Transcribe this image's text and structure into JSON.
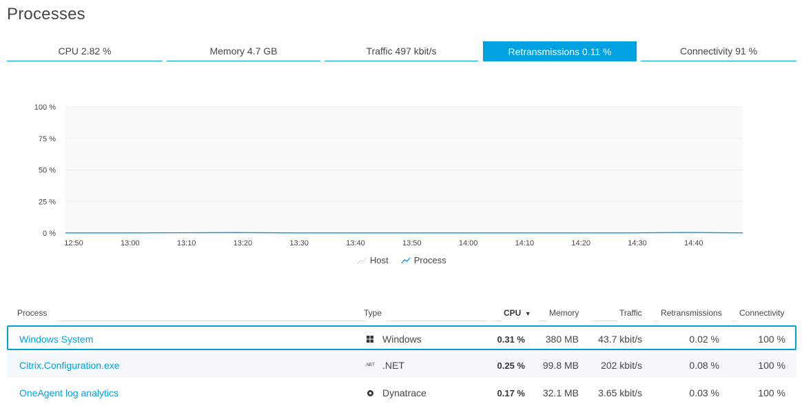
{
  "page": {
    "title": "Processes"
  },
  "tabs": [
    {
      "label": "CPU 2.82 %",
      "active": false
    },
    {
      "label": "Memory 4.7 GB",
      "active": false
    },
    {
      "label": "Traffic 497 kbit/s",
      "active": false
    },
    {
      "label": "Retransmissions 0.11 %",
      "active": true
    },
    {
      "label": "Connectivity 91 %",
      "active": false
    }
  ],
  "colors": {
    "accent": "#00a1e0",
    "text": "#454646",
    "grid": "#eeeeee"
  },
  "chart_data": {
    "type": "line",
    "title": "",
    "ylabel": "",
    "xlabel": "",
    "y_ticks": [
      "100 %",
      "75 %",
      "50 %",
      "25 %",
      "0 %"
    ],
    "ylim": [
      0,
      100
    ],
    "x_ticks": [
      "12:50",
      "13:00",
      "13:10",
      "13:20",
      "13:30",
      "13:40",
      "13:50",
      "14:00",
      "14:10",
      "14:20",
      "14:30",
      "14:40"
    ],
    "grid": true,
    "legend_position": "bottom-center",
    "series": [
      {
        "name": "Host",
        "style": "dotted",
        "color": "#bbbbbb",
        "values": [
          0,
          0,
          0,
          0,
          0,
          0,
          0,
          0,
          0,
          0,
          0,
          0,
          0
        ]
      },
      {
        "name": "Process",
        "style": "line",
        "color": "#00a1e0",
        "values": [
          0.1,
          0.1,
          0.2,
          0.4,
          0.1,
          0.1,
          0.1,
          0.1,
          0.1,
          0.1,
          0.1,
          0.5,
          0.1
        ]
      }
    ]
  },
  "legend": {
    "host_label": "Host",
    "process_label": "Process"
  },
  "table": {
    "columns": {
      "process": "Process",
      "type": "Type",
      "cpu": "CPU",
      "cpu_sort": "▼",
      "memory": "Memory",
      "traffic": "Traffic",
      "retransmissions": "Retransmissions",
      "connectivity": "Connectivity"
    },
    "rows": [
      {
        "process": "Windows System",
        "type_icon": "windows-icon",
        "type": "Windows",
        "cpu": "0.31 %",
        "memory": "380 MB",
        "traffic": "43.7 kbit/s",
        "retransmissions": "0.02 %",
        "connectivity": "100 %",
        "selected": true
      },
      {
        "process": "Citrix.Configuration.exe",
        "type_icon": "dotnet-icon",
        "type_icon_text": ".NET",
        "type": ".NET",
        "cpu": "0.25 %",
        "memory": "99.8 MB",
        "traffic": "202 kbit/s",
        "retransmissions": "0.08 %",
        "connectivity": "100 %",
        "selected": false
      },
      {
        "process": "OneAgent log analytics",
        "type_icon": "dynatrace-icon",
        "type": "Dynatrace",
        "cpu": "0.17 %",
        "memory": "32.1 MB",
        "traffic": "3.65 kbit/s",
        "retransmissions": "0.03 %",
        "connectivity": "100 %",
        "selected": false
      }
    ]
  }
}
